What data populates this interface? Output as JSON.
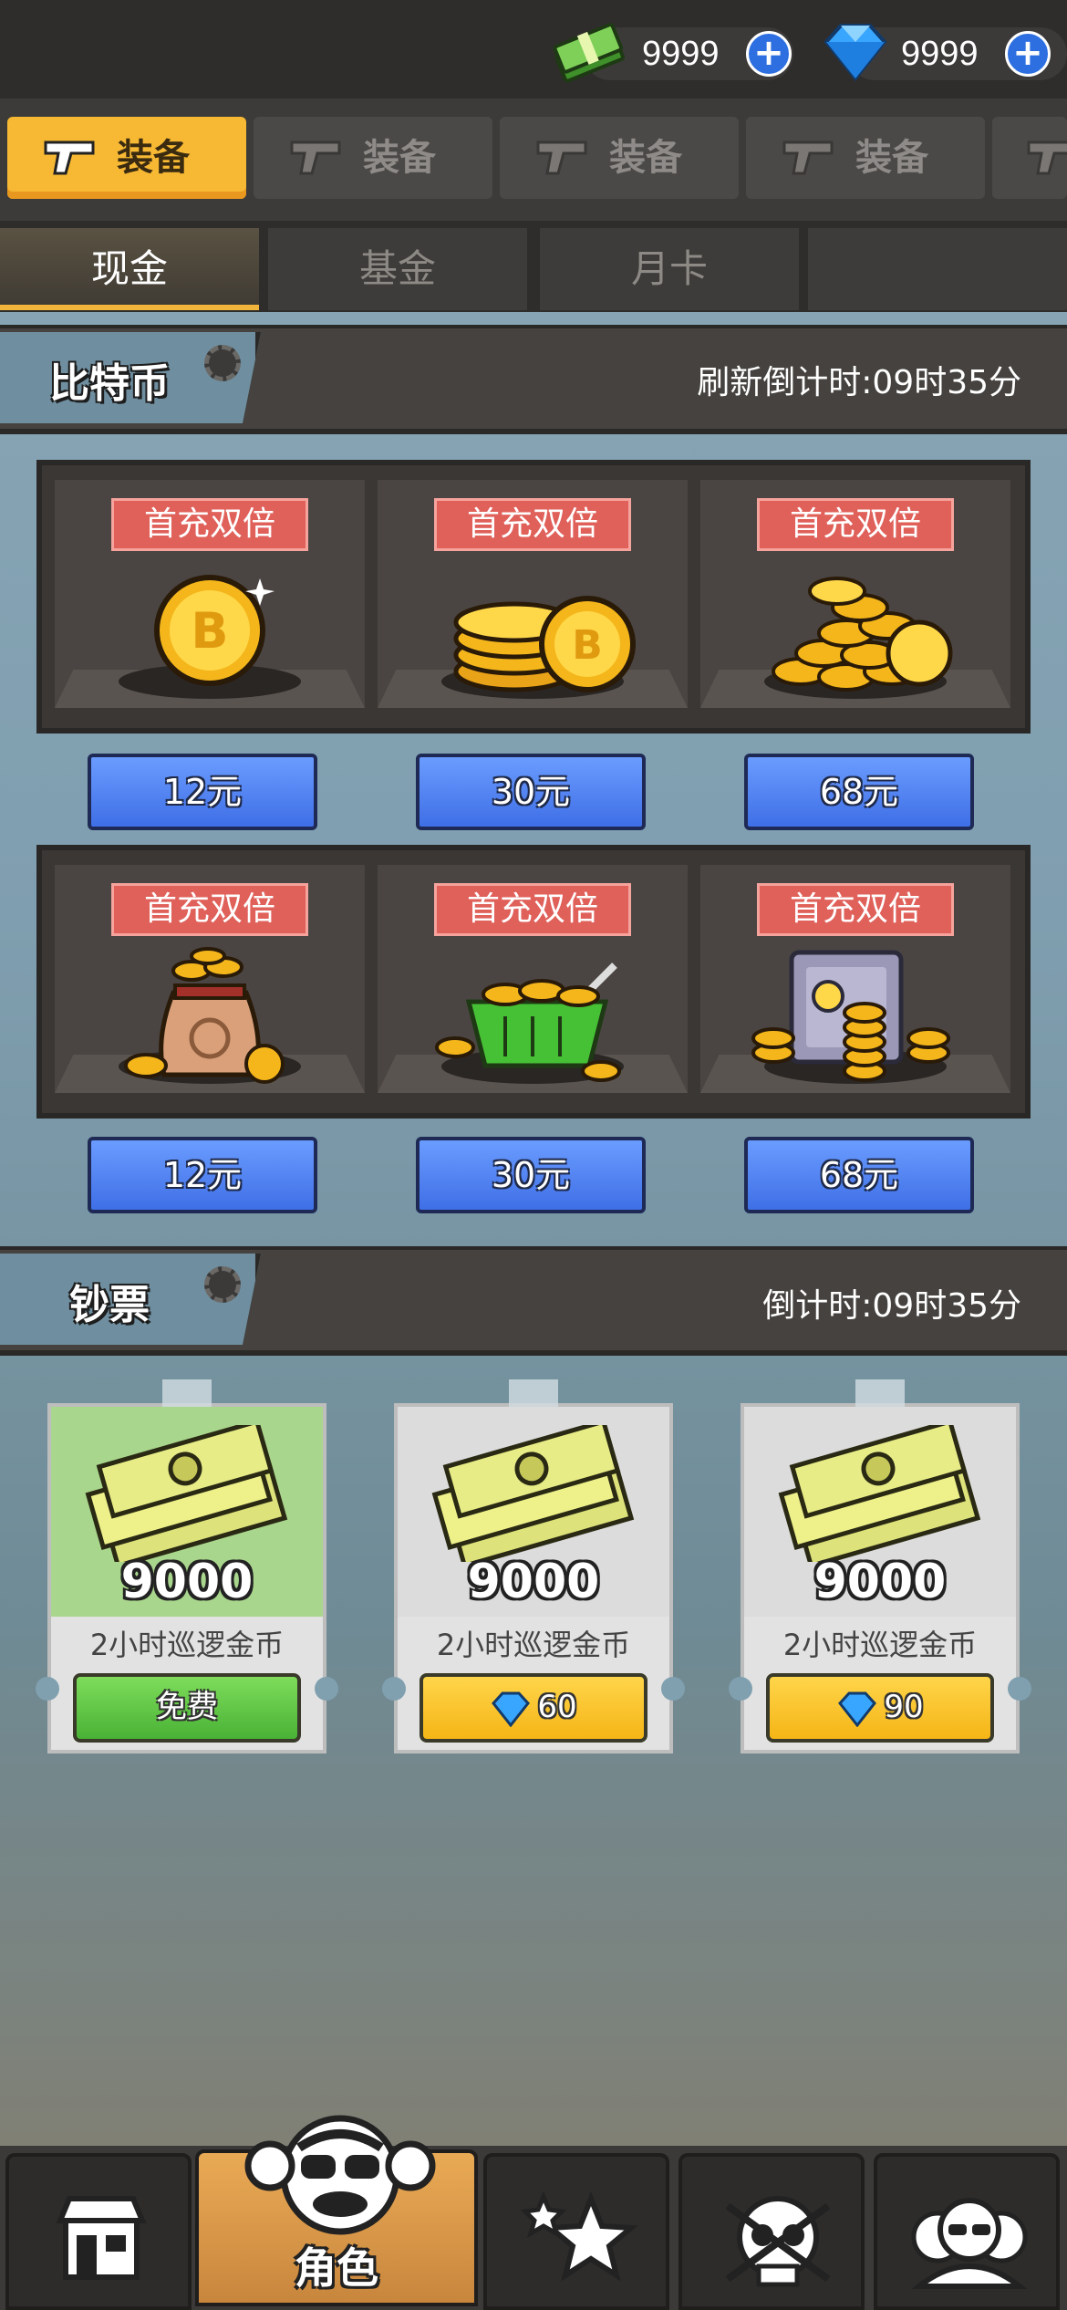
{
  "currency": {
    "cash": "9999",
    "gems": "9999"
  },
  "main_tabs": [
    {
      "label": "装备",
      "active": true
    },
    {
      "label": "装备",
      "active": false
    },
    {
      "label": "装备",
      "active": false
    },
    {
      "label": "装备",
      "active": false
    }
  ],
  "sub_tabs": [
    {
      "label": "现金",
      "active": true
    },
    {
      "label": "基金",
      "active": false
    },
    {
      "label": "月卡",
      "active": false
    },
    {
      "label": "",
      "active": false
    }
  ],
  "bitcoin_section": {
    "title": "比特币",
    "countdown": "刷新倒计时:09时35分",
    "items": [
      {
        "badge": "首充双倍",
        "price": "12元",
        "icon": "single-coin-icon"
      },
      {
        "badge": "首充双倍",
        "price": "30元",
        "icon": "coin-stack-icon"
      },
      {
        "badge": "首充双倍",
        "price": "68元",
        "icon": "coin-pile-icon"
      },
      {
        "badge": "首充双倍",
        "price": "12元",
        "icon": "coin-bag-icon"
      },
      {
        "badge": "首充双倍",
        "price": "30元",
        "icon": "coin-basket-icon"
      },
      {
        "badge": "首充双倍",
        "price": "68元",
        "icon": "coin-safe-icon"
      }
    ]
  },
  "cash_section": {
    "title": "钞票",
    "countdown": "倒计时:09时35分",
    "cards": [
      {
        "amount": "9000",
        "label": "2小时巡逻金币",
        "button": "免费",
        "cost_icon": ""
      },
      {
        "amount": "9000",
        "label": "2小时巡逻金币",
        "button": "60",
        "cost_icon": "gem-icon"
      },
      {
        "amount": "9000",
        "label": "2小时巡逻金币",
        "button": "90",
        "cost_icon": "gem-icon"
      }
    ]
  },
  "bottom_nav": {
    "active_label": "角色",
    "items": [
      "shop-icon",
      "character-icon",
      "stars-icon",
      "skull-icon",
      "team-icon"
    ]
  },
  "colors": {
    "accent_tab": "#f7b934",
    "price_button": "#4f80f0",
    "badge_red": "#e0605a",
    "free_green": "#5cc43f",
    "gem_gold": "#f5b516"
  }
}
